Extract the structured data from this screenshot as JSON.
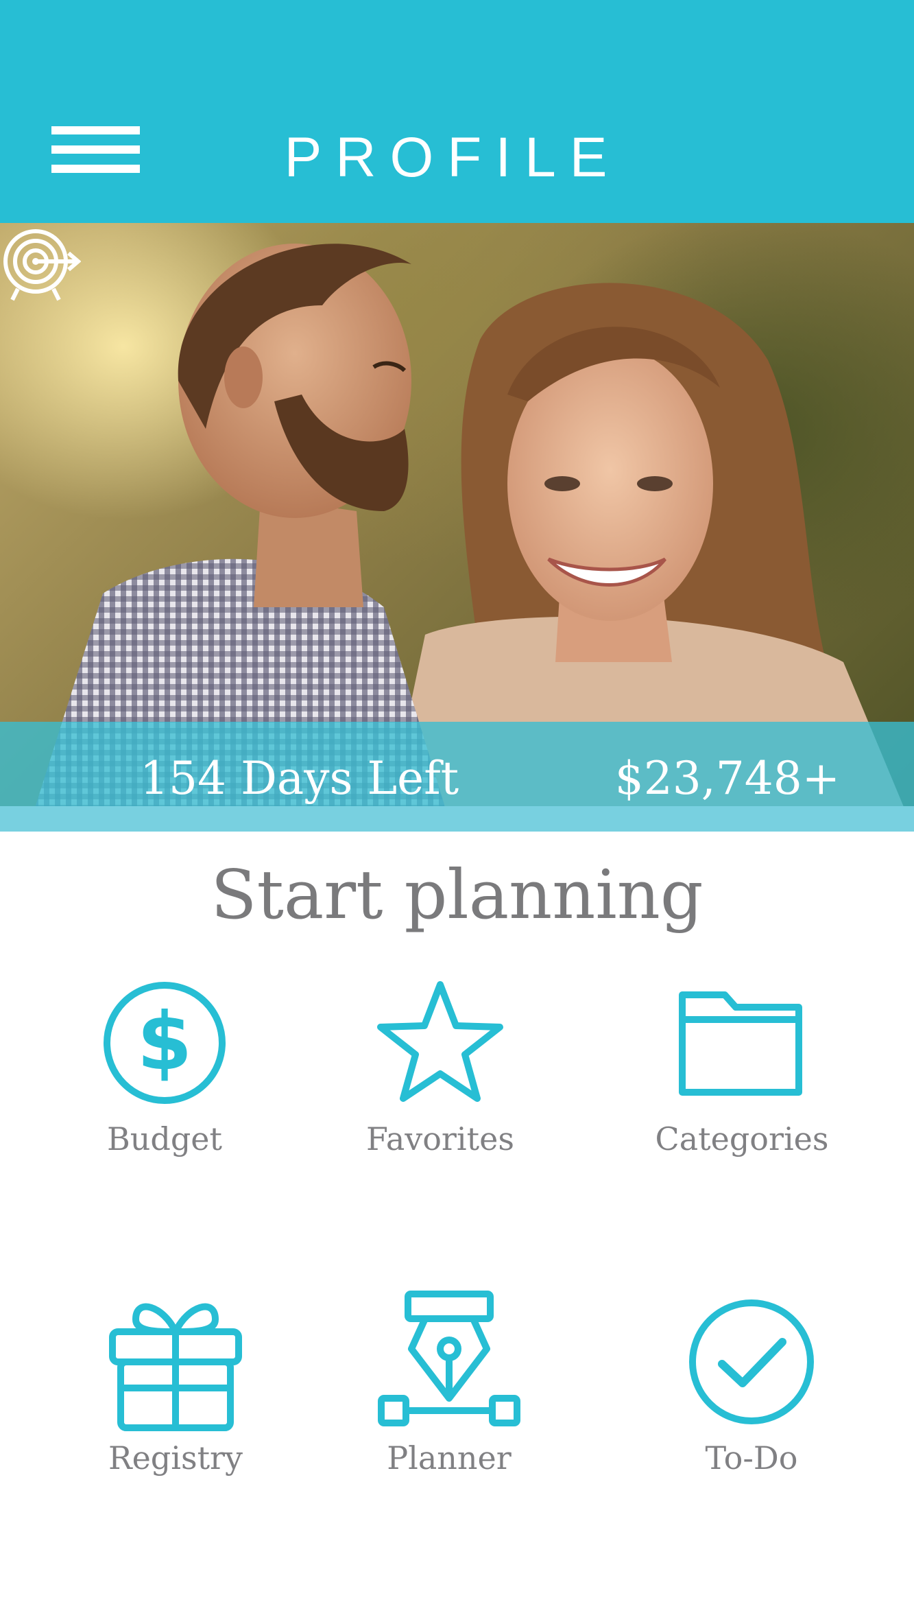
{
  "header": {
    "title": "PROFILE",
    "menu_icon": "hamburger-menu-icon",
    "background_color": "#27bed4"
  },
  "hero": {
    "photo_description_icon": "couple-photo",
    "countdown_icon": "target-icon",
    "days_left": "154 Days Left",
    "budget_total": "$23,748+"
  },
  "planning": {
    "heading": "Start planning",
    "accent_color": "#27bed4",
    "items": [
      {
        "label": "Budget",
        "icon": "dollar-circle-icon"
      },
      {
        "label": "Favorites",
        "icon": "star-icon"
      },
      {
        "label": "Categories",
        "icon": "folder-icon"
      },
      {
        "label": "Registry",
        "icon": "gift-icon"
      },
      {
        "label": "Planner",
        "icon": "pen-tool-icon"
      },
      {
        "label": "To-Do",
        "icon": "checkmark-circle-icon"
      }
    ]
  }
}
